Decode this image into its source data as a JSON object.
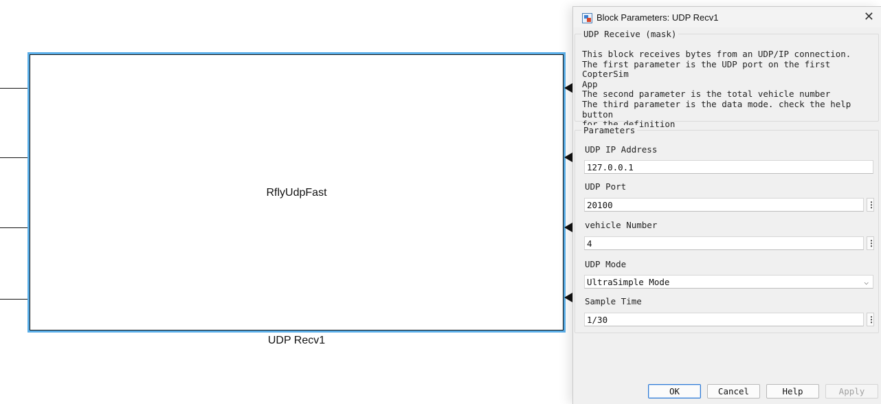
{
  "canvas": {
    "block_title": "RflyUdpFast",
    "block_name": "UDP Recv1"
  },
  "dialog": {
    "title": "Block Parameters: UDP Recv1",
    "close_icon": "close-icon",
    "mask": {
      "legend": "UDP Receive (mask)",
      "description": "This block receives bytes from an UDP/IP connection.\nThe first parameter is the UDP port on the first CopterSim\nApp\nThe second parameter is the total vehicle number\nThe third parameter is the data mode. check the help button\nfor the definition"
    },
    "parameters": {
      "legend": "Parameters",
      "ip_label": "UDP IP Address",
      "ip_value": "127.0.0.1",
      "port_label": "UDP Port",
      "port_value": "20100",
      "vehicle_label": "vehicle Number",
      "vehicle_value": "4",
      "mode_label": "UDP Mode",
      "mode_value": "UltraSimple Mode",
      "sample_label": "Sample Time",
      "sample_value": "1/30",
      "more_glyph": "⋮"
    },
    "buttons": {
      "ok": "OK",
      "cancel": "Cancel",
      "help": "Help",
      "apply": "Apply"
    }
  }
}
